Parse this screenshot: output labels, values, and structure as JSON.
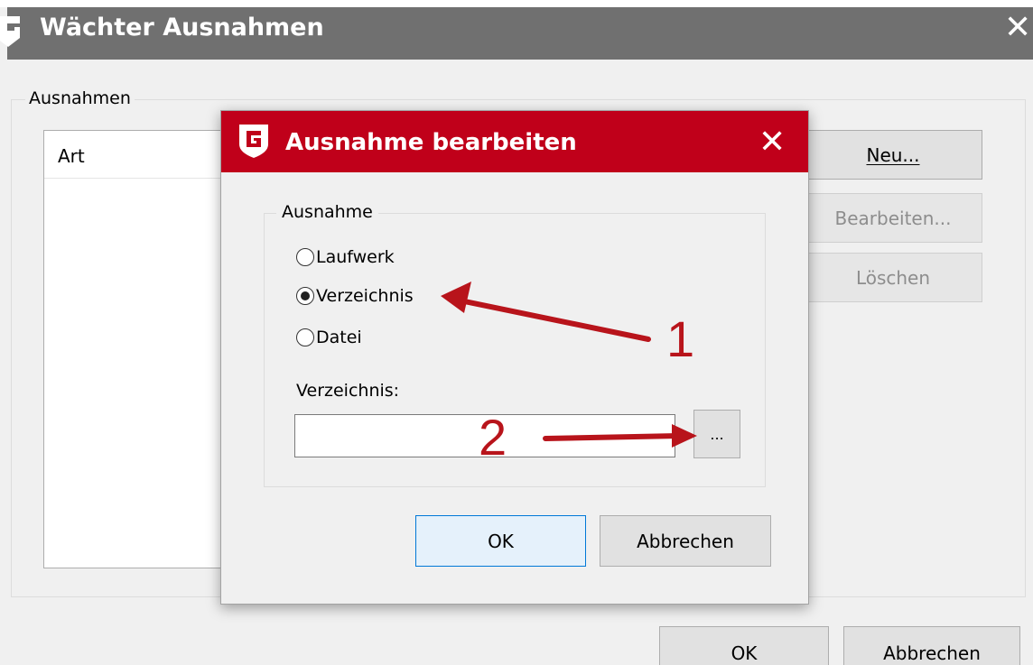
{
  "outer_window": {
    "title": "Wächter Ausnahmen",
    "close_glyph": "✕",
    "groupbox_label": "Ausnahmen",
    "list_header": "Art",
    "buttons": {
      "neu": "Neu...",
      "bearbeiten": "Bearbeiten...",
      "loeschen": "Löschen",
      "ok": "OK",
      "abbrechen": "Abbrechen"
    }
  },
  "dialog": {
    "title": "Ausnahme bearbeiten",
    "close_glyph": "✕",
    "title_color": "#c0001a",
    "group_label": "Ausnahme",
    "radios": [
      {
        "label": "Laufwerk",
        "checked": false
      },
      {
        "label": "Verzeichnis",
        "checked": true
      },
      {
        "label": "Datei",
        "checked": false
      }
    ],
    "field_label": "Verzeichnis:",
    "field_value": "",
    "browse_label": "...",
    "buttons": {
      "ok": "OK",
      "abbrechen": "Abbrechen"
    }
  },
  "annotations": {
    "color": "#b8141b",
    "labels": [
      "1",
      "2"
    ]
  }
}
